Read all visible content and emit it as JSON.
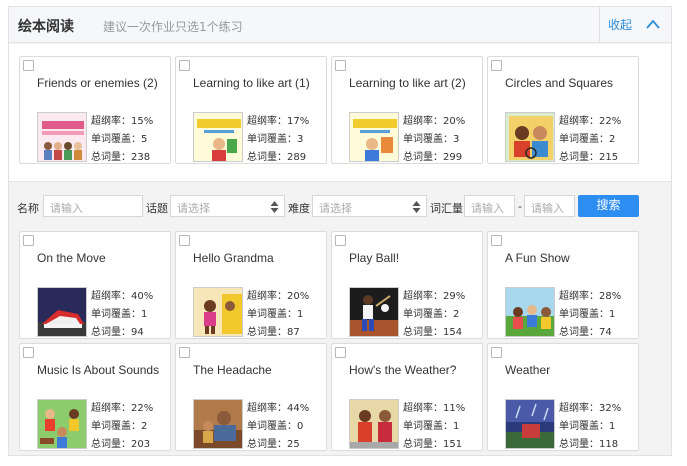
{
  "header": {
    "title": "绘本阅读",
    "hint": "建议一次作业只选1个练习",
    "collapse_label": "收起",
    "collapse_icon": "chevron-up-icon"
  },
  "stat_labels": {
    "rate": "超纲率：",
    "coverage": "单词覆盖：",
    "total": "总词量："
  },
  "selected_books": [
    {
      "title": "Friends or enemies (2)",
      "rate": "15%",
      "coverage": "5",
      "total": "238"
    },
    {
      "title": "Learning to like art (1)",
      "rate": "17%",
      "coverage": "3",
      "total": "289"
    },
    {
      "title": "Learning to like art (2)",
      "rate": "20%",
      "coverage": "3",
      "total": "299"
    },
    {
      "title": "Circles and Squares",
      "rate": "22%",
      "coverage": "2",
      "total": "215"
    }
  ],
  "filter": {
    "name_label": "名称",
    "name_placeholder": "请输入",
    "topic_label": "话题",
    "topic_placeholder": "请选择",
    "difficulty_label": "难度",
    "difficulty_placeholder": "请选择",
    "vocab_label": "词汇量",
    "vocab_min_placeholder": "请输入",
    "vocab_max_placeholder": "请输入",
    "range_dash": "-",
    "search_label": "搜索"
  },
  "books": [
    {
      "title": "On the Move",
      "rate": "40%",
      "coverage": "1",
      "total": "94"
    },
    {
      "title": "Hello Grandma",
      "rate": "20%",
      "coverage": "1",
      "total": "87"
    },
    {
      "title": "Play Ball!",
      "rate": "29%",
      "coverage": "2",
      "total": "154"
    },
    {
      "title": "A Fun Show",
      "rate": "28%",
      "coverage": "1",
      "total": "74"
    },
    {
      "title": "Music Is About Sounds",
      "rate": "22%",
      "coverage": "2",
      "total": "203"
    },
    {
      "title": "The Headache",
      "rate": "44%",
      "coverage": "0",
      "total": "25"
    },
    {
      "title": "How's the Weather?",
      "rate": "11%",
      "coverage": "1",
      "total": "151"
    },
    {
      "title": "Weather",
      "rate": "32%",
      "coverage": "1",
      "total": "118"
    }
  ]
}
